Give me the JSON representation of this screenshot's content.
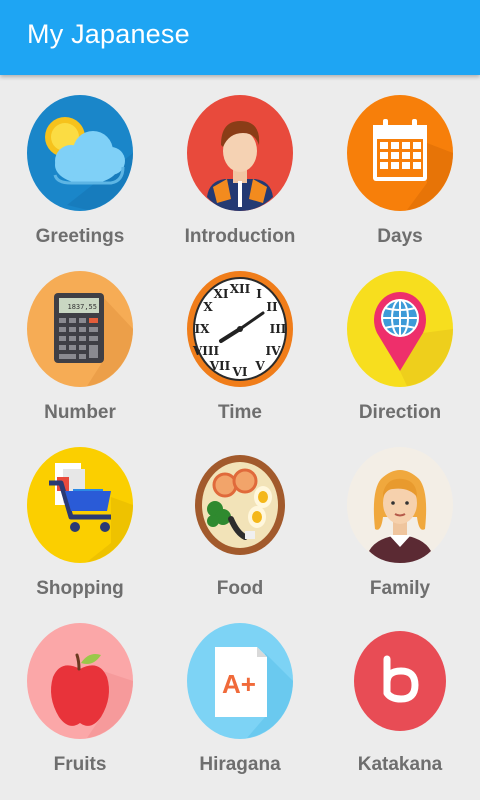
{
  "app": {
    "title": "My Japanese"
  },
  "categories": [
    {
      "label": "Greetings",
      "icon": "weather-cloud-sun-icon"
    },
    {
      "label": "Introduction",
      "icon": "person-icon"
    },
    {
      "label": "Days",
      "icon": "calendar-icon"
    },
    {
      "label": "Number",
      "icon": "calculator-icon"
    },
    {
      "label": "Time",
      "icon": "clock-icon"
    },
    {
      "label": "Direction",
      "icon": "location-globe-icon"
    },
    {
      "label": "Shopping",
      "icon": "shopping-cart-icon"
    },
    {
      "label": "Food",
      "icon": "ramen-bowl-icon"
    },
    {
      "label": "Family",
      "icon": "woman-avatar-icon"
    },
    {
      "label": "Fruits",
      "icon": "apple-icon"
    },
    {
      "label": "Hiragana",
      "icon": "document-a-plus-icon"
    },
    {
      "label": "Katakana",
      "icon": "katakana-b-icon"
    }
  ],
  "calculator_display": "1837,55",
  "hiragana_glyph": "A+",
  "colors": {
    "appbar": "#1ea5f3",
    "background": "#ececec",
    "label": "#6e6e6e"
  }
}
